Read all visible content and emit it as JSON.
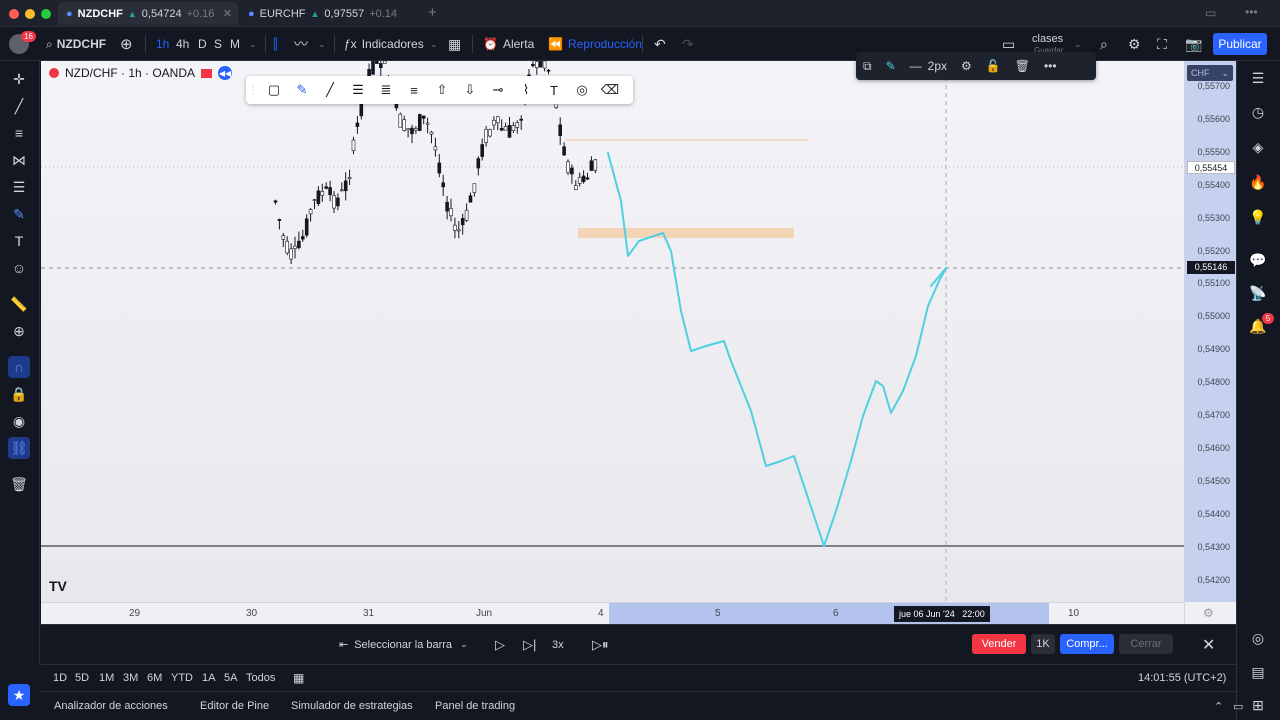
{
  "window_tabs": [
    {
      "symbol": "NZDCHF",
      "price": "0,54724",
      "change": "+0.16",
      "active": true
    },
    {
      "symbol": "EURCHF",
      "price": "0,97557",
      "change": "+0.14",
      "active": false
    }
  ],
  "toolbar": {
    "notification_count": "16",
    "symbol": "NZDCHF",
    "intervals": [
      "1h",
      "4h",
      "D",
      "S",
      "M"
    ],
    "indicators_label": "Indicadores",
    "alert_label": "Alerta",
    "replay_label": "Reproducción",
    "layout_name": "clases",
    "layout_sub": "Guardar",
    "publish_label": "Publicar"
  },
  "chart": {
    "legend_title": "NZD/CHF · 1h · OANDA",
    "currency": "CHF",
    "price_labels": [
      "0,55700",
      "0,55600",
      "0,55500",
      "0,55400",
      "0,55300",
      "0,55200",
      "0,55100",
      "0,55000",
      "0,54900",
      "0,54800",
      "0,54700",
      "0,54600",
      "0,54500",
      "0,54400",
      "0,54300",
      "0,54200"
    ],
    "current_price_badge": "0,55454",
    "crosshair_price_badge": "0,55146",
    "time_labels": [
      "29",
      "30",
      "31",
      "Jun",
      "4",
      "5",
      "6",
      "10"
    ],
    "crosshair_time": "jue 06 Jun '24   22:00",
    "line_width_label": "2px"
  },
  "replay": {
    "select_bar_label": "Seleccionar la barra",
    "speed_label": "3x",
    "sell_label": "Vender",
    "qty_label": "1K",
    "buy_label": "Compr...",
    "close_label": "Cerrar"
  },
  "ranges": {
    "items": [
      "1D",
      "5D",
      "1M",
      "3M",
      "6M",
      "YTD",
      "1A",
      "5A",
      "Todos"
    ],
    "clock": "14:01:55 (UTC+2)"
  },
  "footer": {
    "items": [
      "Analizador de acciones",
      "Editor de Pine",
      "Simulador de estrategias",
      "Panel de trading"
    ]
  },
  "alerts_badge": "5",
  "colors": {
    "accent": "#2962ff",
    "sell": "#f23645",
    "projection_line": "#4dd0e1",
    "zone": "#f5c28a"
  }
}
